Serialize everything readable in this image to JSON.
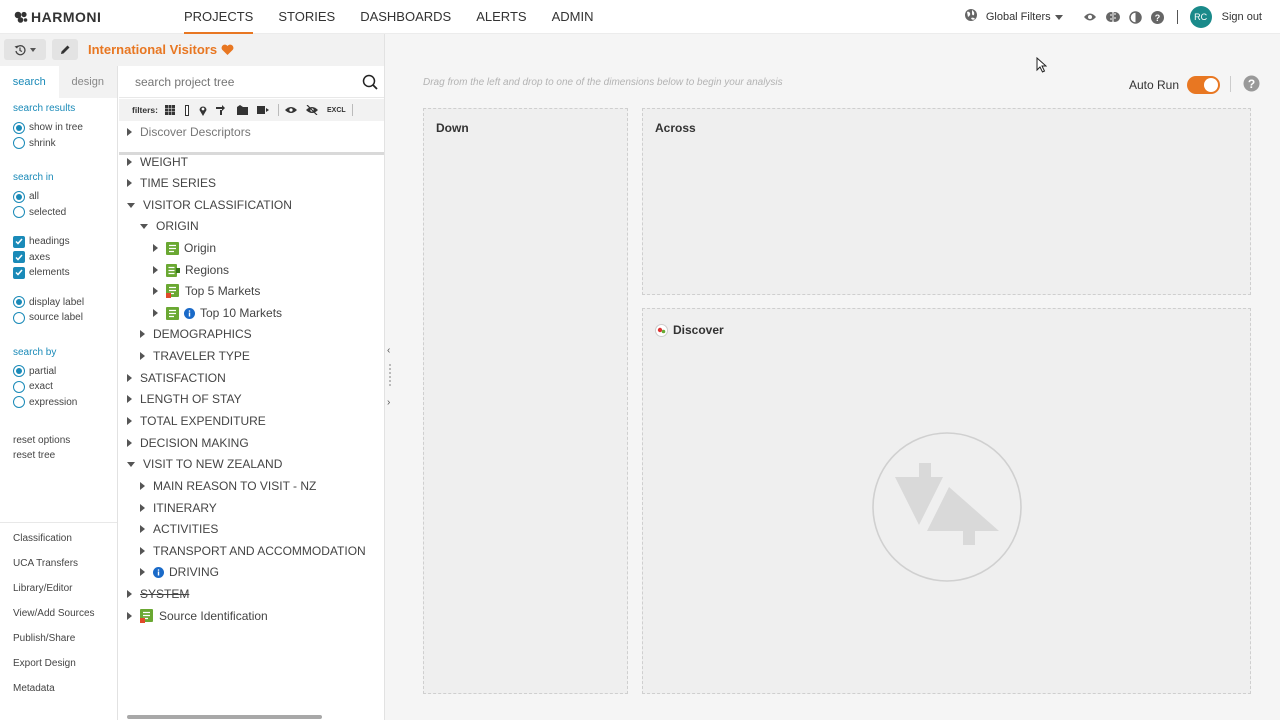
{
  "brand": {
    "name": "HARMONI"
  },
  "nav": [
    {
      "label": "PROJECTS",
      "active": true
    },
    {
      "label": "STORIES"
    },
    {
      "label": "DASHBOARDS"
    },
    {
      "label": "ALERTS"
    },
    {
      "label": "ADMIN"
    }
  ],
  "topbar": {
    "global_filters": "Global Filters",
    "user_initials": "RC",
    "sign_out": "Sign out",
    "icons": [
      "globe-icon",
      "eye-icon",
      "brain-icon",
      "contrast-icon",
      "help-icon"
    ]
  },
  "project": {
    "title": "International Visitors",
    "favorite_icon": "heart-icon",
    "accent": "#e87722"
  },
  "options_panel": {
    "tabs": [
      {
        "label": "search",
        "active": true
      },
      {
        "label": "design"
      }
    ],
    "search_results": {
      "heading": "search results",
      "options": [
        {
          "label": "show in tree",
          "selected": true
        },
        {
          "label": "shrink",
          "selected": false
        }
      ]
    },
    "search_in": {
      "heading": "search in",
      "options": [
        {
          "label": "all",
          "selected": true
        },
        {
          "label": "selected",
          "selected": false
        }
      ],
      "checks": [
        {
          "label": "headings",
          "checked": true
        },
        {
          "label": "axes",
          "checked": true
        },
        {
          "label": "elements",
          "checked": true
        }
      ],
      "label_opts": [
        {
          "label": "display label",
          "selected": true
        },
        {
          "label": "source label",
          "selected": false
        }
      ]
    },
    "search_by": {
      "heading": "search by",
      "options": [
        {
          "label": "partial",
          "selected": true
        },
        {
          "label": "exact",
          "selected": false
        },
        {
          "label": "expression",
          "selected": false
        }
      ]
    },
    "reset": [
      "reset options",
      "reset tree"
    ],
    "links": [
      "Classification",
      "UCA Transfers",
      "Library/Editor",
      "View/Add Sources",
      "Publish/Share",
      "Export Design",
      "Metadata"
    ],
    "accent": "#1a8ab8"
  },
  "tree_panel": {
    "search_placeholder": "search project tree",
    "filters_label": "filters:",
    "excl_label": "EXCL",
    "nodes": [
      {
        "label": "Discover Descriptors",
        "level": 0,
        "state": "collapsed",
        "muted": true
      },
      {
        "label": "WEIGHT",
        "level": 0,
        "state": "collapsed"
      },
      {
        "label": "TIME SERIES",
        "level": 0,
        "state": "collapsed"
      },
      {
        "label": "VISITOR CLASSIFICATION",
        "level": 0,
        "state": "expanded"
      },
      {
        "label": "ORIGIN",
        "level": 1,
        "state": "expanded"
      },
      {
        "label": "Origin",
        "level": 2,
        "state": "collapsed",
        "icon": "variable-icon"
      },
      {
        "label": "Regions",
        "level": 2,
        "state": "collapsed",
        "icon": "grouped-variable-icon"
      },
      {
        "label": "Top 5 Markets",
        "level": 2,
        "state": "collapsed",
        "icon": "derived-variable-icon"
      },
      {
        "label": "Top 10 Markets",
        "level": 2,
        "state": "collapsed",
        "icon": "variable-icon",
        "info": true
      },
      {
        "label": "DEMOGRAPHICS",
        "level": 1,
        "state": "collapsed"
      },
      {
        "label": "TRAVELER TYPE",
        "level": 1,
        "state": "collapsed"
      },
      {
        "label": "SATISFACTION",
        "level": 0,
        "state": "collapsed"
      },
      {
        "label": "LENGTH OF STAY",
        "level": 0,
        "state": "collapsed"
      },
      {
        "label": "TOTAL EXPENDITURE",
        "level": 0,
        "state": "collapsed"
      },
      {
        "label": "DECISION MAKING",
        "level": 0,
        "state": "collapsed"
      },
      {
        "label": "VISIT TO NEW ZEALAND",
        "level": 0,
        "state": "expanded"
      },
      {
        "label": "MAIN REASON TO VISIT - NZ",
        "level": 1,
        "state": "collapsed"
      },
      {
        "label": "ITINERARY",
        "level": 1,
        "state": "collapsed"
      },
      {
        "label": "ACTIVITIES",
        "level": 1,
        "state": "collapsed"
      },
      {
        "label": "TRANSPORT AND ACCOMMODATION",
        "level": 1,
        "state": "collapsed"
      },
      {
        "label": "DRIVING",
        "level": 1,
        "state": "collapsed",
        "info": true
      },
      {
        "label": "SYSTEM",
        "level": 0,
        "state": "collapsed",
        "strike": true
      },
      {
        "label": "Source Identification",
        "level": 0,
        "state": "collapsed",
        "icon": "derived-variable-icon"
      }
    ]
  },
  "workspace": {
    "hint": "Drag from the left and drop to one of the dimensions below to begin your analysis",
    "auto_run_label": "Auto Run",
    "auto_run_on": true,
    "zones": {
      "down": "Down",
      "across": "Across",
      "discover": "Discover"
    }
  }
}
